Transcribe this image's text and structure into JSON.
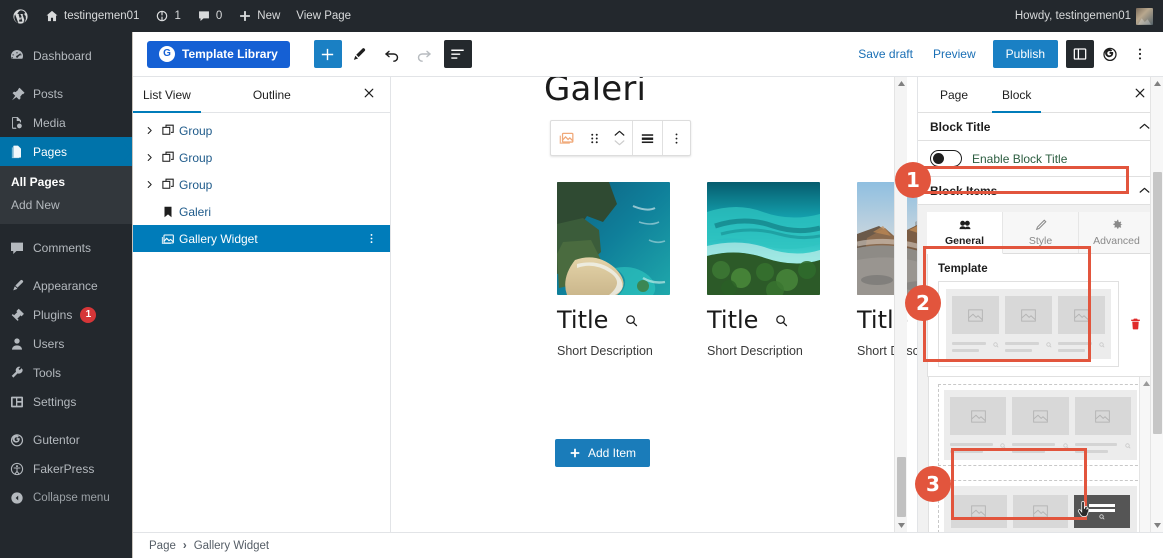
{
  "adminbar": {
    "site_name": "testingemen01",
    "updates_count": "1",
    "comments_count": "0",
    "new_label": "New",
    "view_page_label": "View Page",
    "howdy": "Howdy, testingemen01"
  },
  "adminmenu": {
    "items": [
      {
        "label": "Dashboard",
        "icon": "dashboard-icon"
      },
      {
        "label": "Posts",
        "icon": "pin-icon"
      },
      {
        "label": "Media",
        "icon": "media-icon"
      },
      {
        "label": "Pages",
        "icon": "pages-icon",
        "active": true
      },
      {
        "label": "Comments",
        "icon": "comment-icon"
      },
      {
        "label": "Appearance",
        "icon": "brush-icon"
      },
      {
        "label": "Plugins",
        "icon": "plug-icon",
        "badge": "1"
      },
      {
        "label": "Users",
        "icon": "user-icon"
      },
      {
        "label": "Tools",
        "icon": "wrench-icon"
      },
      {
        "label": "Settings",
        "icon": "sliders-icon"
      },
      {
        "label": "Gutentor",
        "icon": "gutentor-icon"
      },
      {
        "label": "FakerPress",
        "icon": "fakerpress-icon"
      },
      {
        "label": "Collapse menu",
        "icon": "collapse-icon"
      }
    ],
    "submenu": {
      "all_pages": "All Pages",
      "add_new": "Add New"
    }
  },
  "toolbar": {
    "template_library": "Template Library",
    "save_draft": "Save draft",
    "preview": "Preview",
    "publish": "Publish",
    "icons": {
      "add_block": "plus-icon",
      "edit_tool": "pencil-icon",
      "undo": "undo-arrow-icon",
      "redo": "redo-arrow-icon",
      "list_view": "list-view-icon",
      "sidebar_toggle": "sidebar-toggle-icon",
      "gutentor": "gutentor-icon",
      "options": "three-dots-vertical-icon"
    }
  },
  "listview": {
    "tabs": [
      {
        "label": "List View",
        "active": true
      },
      {
        "label": "Outline",
        "active": false
      }
    ],
    "close_icon": "close-icon",
    "rows": [
      {
        "label": "Group",
        "icon": "group-block-icon",
        "expandable": true
      },
      {
        "label": "Group",
        "icon": "group-block-icon",
        "expandable": true
      },
      {
        "label": "Group",
        "icon": "group-block-icon",
        "expandable": true
      },
      {
        "label": "Galeri",
        "icon": "heading-block-icon",
        "expandable": false
      },
      {
        "label": "Gallery Widget",
        "icon": "gallery-block-icon",
        "expandable": false,
        "selected": true
      }
    ]
  },
  "canvas": {
    "heading": "Galeri",
    "block_toolbar_icons": [
      "gallery-block-icon",
      "drag-handle-icon",
      "move-up-down-icon",
      "align-icon",
      "three-dots-vertical-icon"
    ],
    "items": [
      {
        "title": "Title",
        "description": "Short Description",
        "search_icon": "search-icon"
      },
      {
        "title": "Title",
        "description": "Short Description",
        "search_icon": "search-icon"
      },
      {
        "title": "Title",
        "description": "Short Description",
        "search_icon": "search-icon"
      }
    ],
    "add_item_label": "Add Item"
  },
  "settings": {
    "tabs": [
      {
        "label": "Page",
        "active": false
      },
      {
        "label": "Block",
        "active": true
      }
    ],
    "close_icon": "close-icon",
    "block_title_panel": {
      "title": "Block Title",
      "collapse_icon": "chevron-up-icon",
      "toggle_label": "Enable Block Title",
      "toggle_on": false
    },
    "block_items_panel": {
      "title": "Block Items",
      "collapse_icon": "chevron-up-icon"
    },
    "gtabs": [
      {
        "label": "General",
        "icon": "general-icon",
        "active": true
      },
      {
        "label": "Style",
        "icon": "pencil-icon",
        "active": false
      },
      {
        "label": "Advanced",
        "icon": "gear-icon",
        "active": false
      }
    ],
    "template": {
      "label": "Template",
      "delete_icon": "trash-icon"
    }
  },
  "steps": [
    {
      "number": "1"
    },
    {
      "number": "2"
    },
    {
      "number": "3"
    }
  ],
  "breadcrumb": {
    "parent": "Page",
    "separator": "›",
    "current": "Gallery Widget"
  },
  "colors": {
    "admin_dark": "#23282d",
    "wp_blue": "#0073aa",
    "accent_blue": "#1a80c4",
    "template_library_blue": "#1560d4",
    "highlight_orange": "#e2553d",
    "badge_red": "#d63638"
  }
}
